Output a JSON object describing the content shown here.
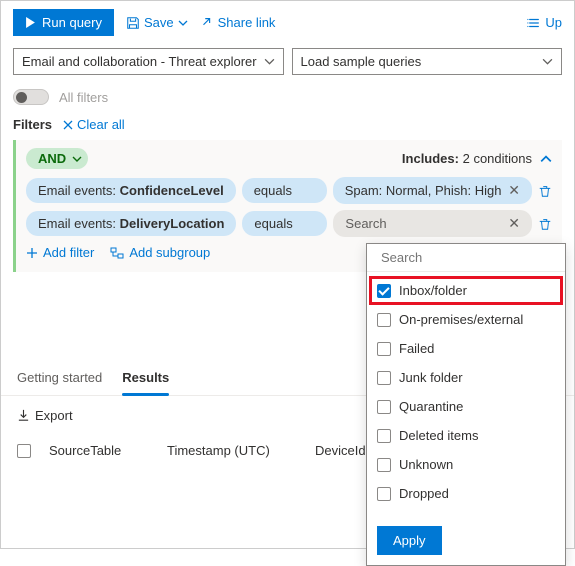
{
  "toolbar": {
    "run": "Run query",
    "save": "Save",
    "share": "Share link",
    "up": "Up"
  },
  "scope_dropdown": "Email and collaboration - Threat explorer",
  "sample_dropdown": "Load sample queries",
  "all_filters": "All filters",
  "filters_label": "Filters",
  "clear_all": "Clear all",
  "group": {
    "operator": "AND",
    "includes_label": "Includes:",
    "includes_count": "2 conditions"
  },
  "conditions": [
    {
      "field_prefix": "Email events: ",
      "field": "ConfidenceLevel",
      "op": "equals",
      "val": "Spam: Normal, Phish: High"
    },
    {
      "field_prefix": "Email events: ",
      "field": "DeliveryLocation",
      "op": "equals",
      "val": "Search"
    }
  ],
  "add_filter": "Add filter",
  "add_subgroup": "Add subgroup",
  "tabs": {
    "getting_started": "Getting started",
    "results": "Results"
  },
  "export": "Export",
  "columns": {
    "source": "SourceTable",
    "timestamp": "Timestamp (UTC)",
    "device": "DeviceId"
  },
  "popover": {
    "search_placeholder": "Search",
    "options": [
      {
        "label": "Inbox/folder",
        "checked": true,
        "hl": true
      },
      {
        "label": "On-premises/external",
        "checked": false
      },
      {
        "label": "Failed",
        "checked": false
      },
      {
        "label": "Junk folder",
        "checked": false
      },
      {
        "label": "Quarantine",
        "checked": false
      },
      {
        "label": "Deleted items",
        "checked": false
      },
      {
        "label": "Unknown",
        "checked": false
      },
      {
        "label": "Dropped",
        "checked": false
      }
    ],
    "apply": "Apply"
  }
}
